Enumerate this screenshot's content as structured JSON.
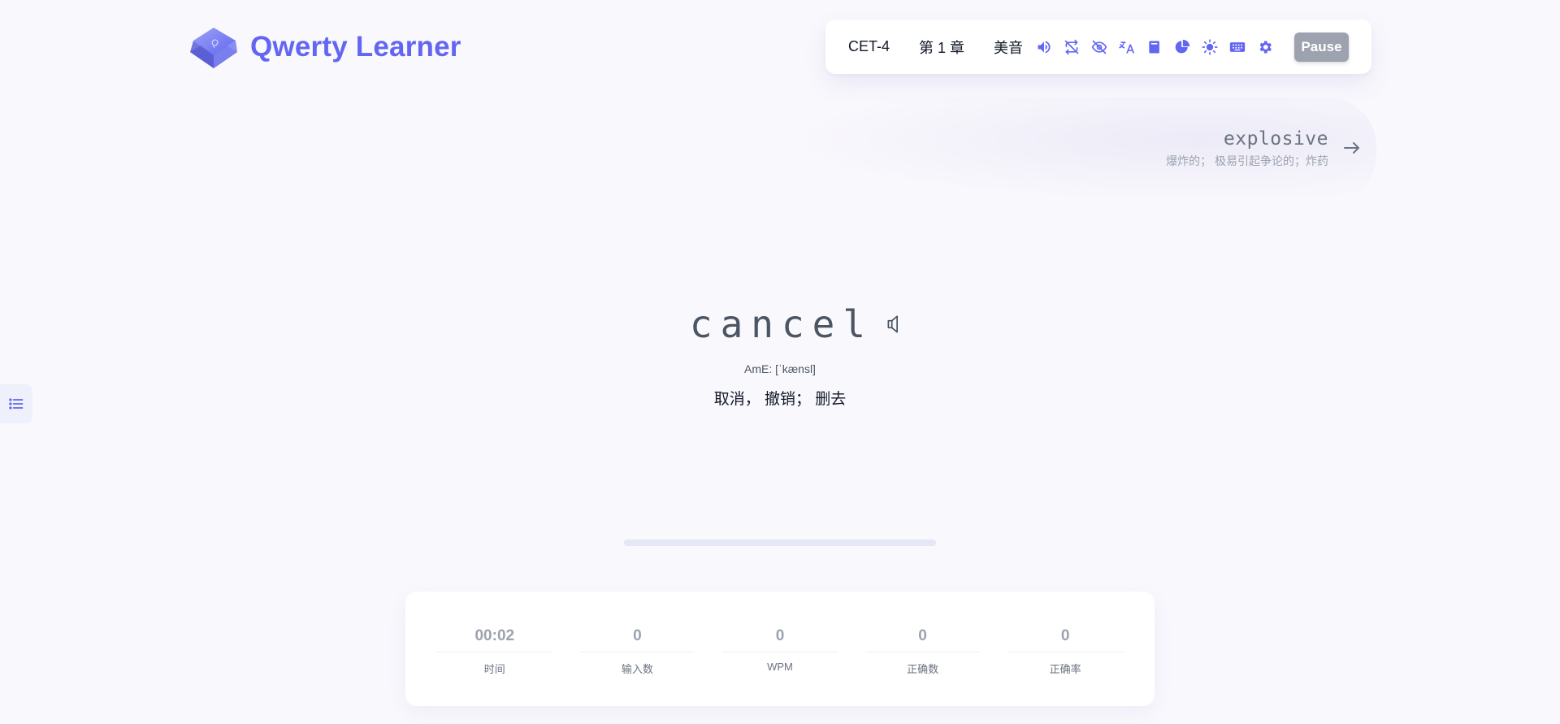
{
  "app": {
    "title": "Qwerty Learner",
    "accent_color": "#6366f1"
  },
  "toolbar": {
    "dictionary": "CET-4",
    "chapter": "第 1 章",
    "pronunciation": "美音",
    "icons": [
      "speaker-icon",
      "loop-icon",
      "hide-icon",
      "translate-icon",
      "book-icon",
      "chart-pie-icon",
      "sun-icon",
      "keyboard-icon",
      "gear-icon"
    ],
    "pause_label": "Pause"
  },
  "next_word": {
    "word": "explosive",
    "translation": "爆炸的； 极易引起争论的；炸药"
  },
  "current_word": {
    "word": "cancel",
    "phonetic": "AmE: [ˈkænsl]",
    "translation": "取消， 撤销； 删去"
  },
  "progress": {
    "percent": 0
  },
  "stats": [
    {
      "value": "00:02",
      "label": "时间"
    },
    {
      "value": "0",
      "label": "输入数"
    },
    {
      "value": "0",
      "label": "WPM"
    },
    {
      "value": "0",
      "label": "正确数"
    },
    {
      "value": "0",
      "label": "正确率"
    }
  ]
}
